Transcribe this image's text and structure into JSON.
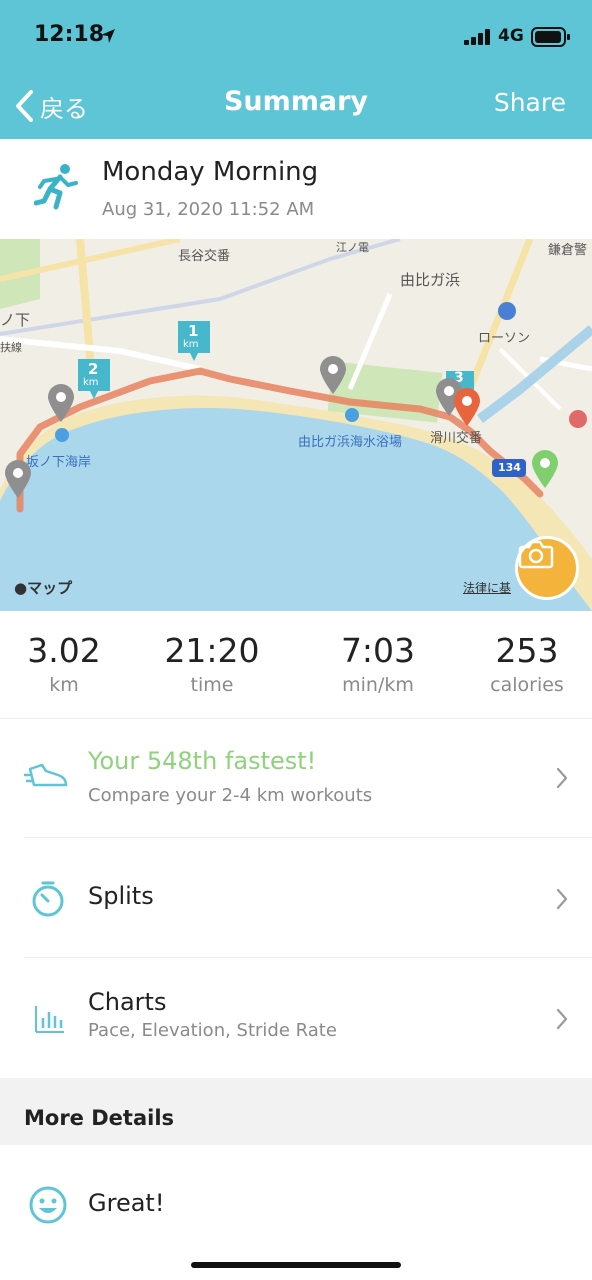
{
  "status_bar": {
    "time": "12:18",
    "carrier": "4G"
  },
  "nav": {
    "back_label": "戻る",
    "title": "Summary",
    "share_label": "Share"
  },
  "activity": {
    "title": "Monday Morning",
    "date": "Aug 31, 2020 11:52 AM"
  },
  "map": {
    "labels": {
      "hase": "長谷交番",
      "yuigahama": "由比ガ浜",
      "kamakura": "鎌倉警",
      "lawson": "ローソン",
      "sakanoshita": "坂ノ下海岸",
      "beach": "由比ガ浜海水浴場",
      "namerikawa": "滑川交番",
      "enoden": "江ノ電",
      "noshita": "ノ下",
      "line": "扶線",
      "route": "134"
    },
    "km_markers": [
      "1",
      "2",
      "3"
    ],
    "km_unit": "km",
    "attribution": "マップ",
    "legal": "法律に基"
  },
  "stats": [
    {
      "value": "3.02",
      "unit": "km"
    },
    {
      "value": "21:20",
      "unit": "time"
    },
    {
      "value": "7:03",
      "unit": "min/km"
    },
    {
      "value": "253",
      "unit": "calories"
    }
  ],
  "rows": {
    "fastest": {
      "primary": "Your 548th fastest!",
      "secondary": "Compare your 2-4 km workouts"
    },
    "splits": {
      "primary": "Splits"
    },
    "charts": {
      "primary": "Charts",
      "secondary": "Pace, Elevation, Stride Rate"
    },
    "feeling": {
      "primary": "Great!"
    }
  },
  "section": {
    "more_details": "More Details"
  },
  "colors": {
    "accent": "#5ec5d6",
    "highlight_green": "#8fd27a",
    "route": "#e8825f",
    "camera": "#f4b43c"
  }
}
